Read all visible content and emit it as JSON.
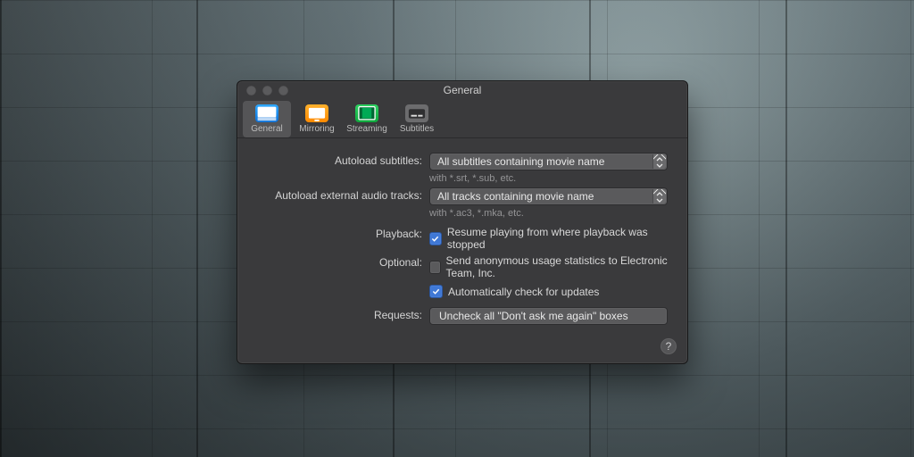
{
  "window": {
    "title": "General"
  },
  "toolbar": {
    "tabs": [
      {
        "label": "General",
        "selected": true,
        "icon": "general-icon"
      },
      {
        "label": "Mirroring",
        "selected": false,
        "icon": "mirroring-icon"
      },
      {
        "label": "Streaming",
        "selected": false,
        "icon": "streaming-icon"
      },
      {
        "label": "Subtitles",
        "selected": false,
        "icon": "subtitles-icon"
      }
    ]
  },
  "form": {
    "autoload_subtitles": {
      "label": "Autoload subtitles:",
      "value": "All subtitles containing movie name",
      "hint": "with *.srt, *.sub, etc."
    },
    "autoload_audio": {
      "label": "Autoload external audio tracks:",
      "value": "All tracks containing movie name",
      "hint": "with *.ac3, *.mka, etc."
    },
    "playback": {
      "label": "Playback:",
      "resume_label": "Resume playing from where playback was stopped",
      "resume_checked": true
    },
    "optional": {
      "label": "Optional:",
      "stats_label": "Send anonymous usage statistics to Electronic Team, Inc.",
      "stats_checked": false,
      "updates_label": "Automatically check for updates",
      "updates_checked": true
    },
    "requests": {
      "label": "Requests:",
      "button": "Uncheck all \"Don't ask me again\" boxes"
    }
  },
  "help": {
    "glyph": "?"
  }
}
